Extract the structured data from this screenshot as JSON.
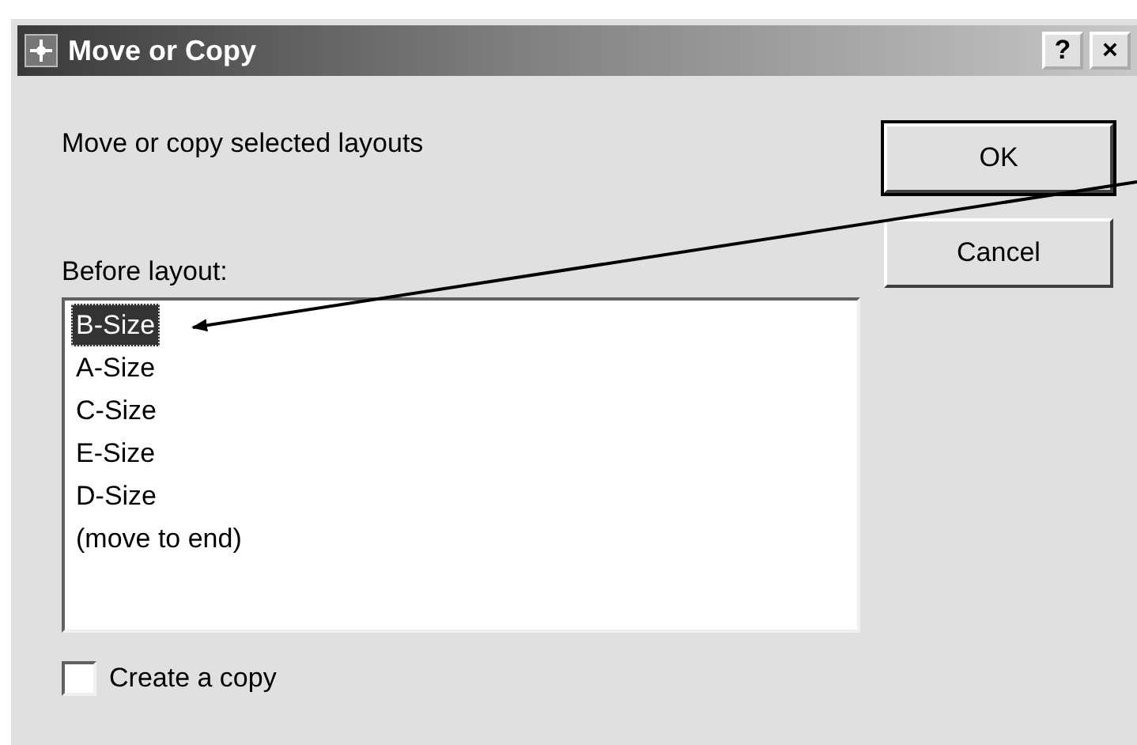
{
  "window": {
    "title": "Move or Copy",
    "title_buttons": [
      "?",
      "×"
    ]
  },
  "prompt": "Move or copy selected layouts",
  "buttons": [
    {
      "label": "OK",
      "default": true
    },
    {
      "label": "Cancel",
      "default": false
    }
  ],
  "list_label": "Before layout:",
  "layouts": [
    {
      "label": "B-Size",
      "selected": true
    },
    {
      "label": "A-Size",
      "selected": false
    },
    {
      "label": "C-Size",
      "selected": false
    },
    {
      "label": "E-Size",
      "selected": false
    },
    {
      "label": "D-Size",
      "selected": false
    },
    {
      "label": "(move to end)",
      "selected": false
    }
  ],
  "create_copy": {
    "label": "Create a copy",
    "checked": false
  }
}
